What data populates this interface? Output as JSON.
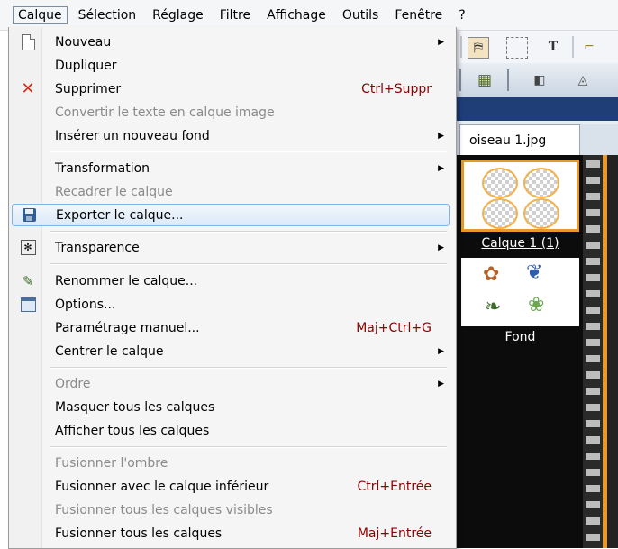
{
  "menubar": {
    "items": [
      "Calque",
      "Sélection",
      "Réglage",
      "Filtre",
      "Affichage",
      "Outils",
      "Fenêtre",
      "?"
    ]
  },
  "document_tab": {
    "title": "oiseau 1.jpg"
  },
  "layers": [
    {
      "name": "Calque 1 (1)",
      "selected": true
    },
    {
      "name": "Fond",
      "selected": false
    }
  ],
  "menu": {
    "items": [
      {
        "label": "Nouveau",
        "submenu": true,
        "icon": "new-document-icon"
      },
      {
        "label": "Dupliquer"
      },
      {
        "label": "Supprimer",
        "shortcut": "Ctrl+Suppr",
        "icon": "delete-x-icon"
      },
      {
        "label": "Convertir le texte en calque image",
        "disabled": true
      },
      {
        "label": "Insérer un nouveau fond",
        "submenu": true
      },
      {
        "label": "Transformation",
        "submenu": true
      },
      {
        "label": "Recadrer le calque",
        "disabled": true
      },
      {
        "label": "Exporter le calque...",
        "icon": "save-disk-icon",
        "highlighted": true
      },
      {
        "label": "Transparence",
        "submenu": true,
        "icon": "transparency-icon"
      },
      {
        "label": "Renommer le calque...",
        "icon": "rename-pencil-icon"
      },
      {
        "label": "Options...",
        "icon": "options-window-icon"
      },
      {
        "label": "Paramétrage manuel...",
        "shortcut": "Maj+Ctrl+G"
      },
      {
        "label": "Centrer le calque",
        "submenu": true
      },
      {
        "label": "Ordre",
        "submenu": true,
        "disabled": true
      },
      {
        "label": "Masquer tous les calques"
      },
      {
        "label": "Afficher tous les calques"
      },
      {
        "label": "Fusionner l'ombre",
        "disabled": true
      },
      {
        "label": "Fusionner avec le calque inférieur",
        "shortcut": "Ctrl+Entrée"
      },
      {
        "label": "Fusionner tous les calques visibles",
        "disabled": true
      },
      {
        "label": "Fusionner tous les calques",
        "shortcut": "Maj+Entrée"
      }
    ]
  },
  "colors": {
    "highlight_border": "#7eb4ea",
    "shortcut_text": "#8b0000",
    "disabled_text": "#8a8a8a",
    "selected_layer_border": "#e59a2a"
  }
}
